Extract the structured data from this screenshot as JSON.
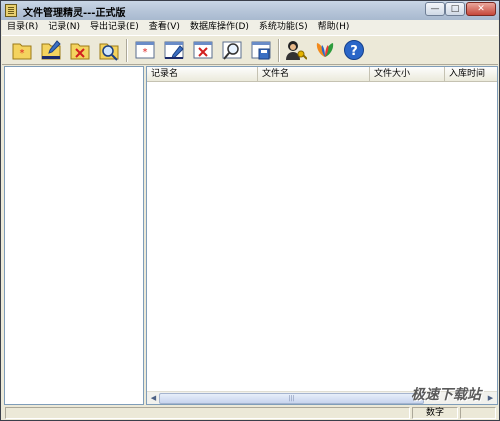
{
  "window": {
    "title": "文件管理精灵---正式版",
    "controls": {
      "minimize": "—",
      "maximize": "□",
      "close": "✕"
    }
  },
  "menubar": {
    "items": [
      {
        "label": "目录(R)"
      },
      {
        "label": "记录(N)"
      },
      {
        "label": "导出记录(E)"
      },
      {
        "label": "查看(V)"
      },
      {
        "label": "数据库操作(D)"
      },
      {
        "label": "系统功能(S)"
      },
      {
        "label": "帮助(H)"
      }
    ]
  },
  "toolbar": {
    "buttons": [
      {
        "name": "new-folder-icon",
        "color": "#f4d35e"
      },
      {
        "name": "edit-folder-icon",
        "color": "#f4d35e"
      },
      {
        "name": "delete-folder-icon",
        "color": "#f4d35e"
      },
      {
        "name": "search-folder-icon",
        "color": "#f4d35e"
      },
      {
        "name": "new-record-icon",
        "color": "#6a8cc7"
      },
      {
        "name": "edit-record-icon",
        "color": "#6a8cc7"
      },
      {
        "name": "delete-record-icon",
        "color": "#6a8cc7"
      },
      {
        "name": "search-record-icon",
        "color": "#6a8cc7"
      },
      {
        "name": "save-record-icon",
        "color": "#6a8cc7"
      },
      {
        "name": "user-key-icon",
        "color": "#333333"
      },
      {
        "name": "msn-butterfly-icon",
        "color": "#2d9c3c"
      },
      {
        "name": "help-icon",
        "color": "#2a66c8"
      }
    ]
  },
  "table": {
    "columns": [
      "记录名",
      "文件名",
      "文件大小",
      "入库时间"
    ],
    "rows": []
  },
  "statusbar": {
    "numlock": "数字"
  },
  "watermark": "极速下载站",
  "colors": {
    "accent": "#7f9db9",
    "window_bg": "#ece9d8",
    "close_button": "#c5473a"
  }
}
